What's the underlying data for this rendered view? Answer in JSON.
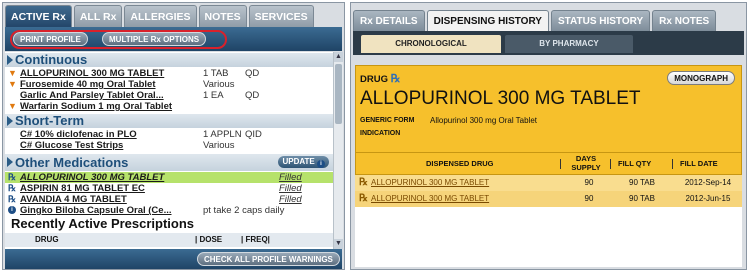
{
  "left": {
    "tabs": [
      "ACTIVE Rx",
      "ALL Rx",
      "ALLERGIES",
      "NOTES",
      "SERVICES"
    ],
    "toolbar": {
      "print_profile": "PRINT PROFILE",
      "multiple_rx": "MULTIPLE Rx OPTIONS"
    },
    "sections": {
      "continuous": "Continuous",
      "short_term": "Short-Term",
      "other": "Other Medications",
      "update": "UPDATE",
      "recent": "Recently Active Prescriptions"
    },
    "continuous_rows": [
      {
        "name": "ALLOPURINOL 300 MG TABLET",
        "dose": "1 TAB",
        "freq": "QD"
      },
      {
        "name": "Furosemide 40 mg Oral Tablet",
        "dose": "Various",
        "freq": ""
      },
      {
        "name": "Garlic And Parsley Tablet Oral...",
        "dose": "1 EA",
        "freq": "QD"
      },
      {
        "name": "Warfarin Sodium 1 mg Oral Tablet",
        "dose": "",
        "freq": ""
      }
    ],
    "short_term_rows": [
      {
        "name": "C# 10% diclofenac in PLO",
        "dose": "1 APPLN",
        "freq": "QID"
      },
      {
        "name": "C# Glucose Test Strips",
        "dose": "Various",
        "freq": ""
      }
    ],
    "other_rows": [
      {
        "name": "ALLOPURINOL 300 MG TABLET",
        "status": "Filled"
      },
      {
        "name": "ASPIRIN 81 MG TABLET EC",
        "status": "Filled"
      },
      {
        "name": "AVANDIA 4 MG TABLET",
        "status": "Filled"
      },
      {
        "name": "Gingko Biloba Capsule Oral (Ce...",
        "status": "pt take 2 caps daily"
      }
    ],
    "recent_headers": {
      "drug": "DRUG",
      "dose": "| DOSE",
      "freq": "| FREQ|"
    },
    "footer_button": "CHECK ALL PROFILE WARNINGS"
  },
  "right": {
    "tabs": [
      "Rx DETAILS",
      "DISPENSING HISTORY",
      "STATUS HISTORY",
      "Rx NOTES"
    ],
    "subtabs": [
      "CHRONOLOGICAL",
      "BY PHARMACY"
    ],
    "drug_label": "DRUG",
    "rx_symbol": "℞",
    "monograph": "MONOGRAPH",
    "drug_name": "ALLOPURINOL 300 MG TABLET",
    "generic_form_label": "GENERIC FORM",
    "generic_form_value": "Allopurinol 300 mg Oral Tablet",
    "indication_label": "INDICATION",
    "table": {
      "headers": {
        "drug": "DISPENSED DRUG",
        "days_1": "DAYS",
        "days_2": "SUPPLY",
        "qty": "FILL QTY",
        "date": "FILL DATE"
      },
      "rows": [
        {
          "drug": "ALLOPURINOL 300 MG TABLET",
          "days": "90",
          "qty": "90 TAB",
          "date": "2012-Sep-14"
        },
        {
          "drug": "ALLOPURINOL 300 MG TABLET",
          "days": "90",
          "qty": "90 TAB",
          "date": "2012-Jun-15"
        }
      ]
    }
  },
  "colors": {
    "accent_blue": "#23466a",
    "highlight_green": "#b6e26b",
    "drug_gold": "#f6c02c",
    "alert_red": "#d9212b"
  },
  "icons": [
    "orange-triangle-icon",
    "rx-icon",
    "info-circle-icon",
    "scroll-up-icon",
    "scroll-down-icon"
  ]
}
